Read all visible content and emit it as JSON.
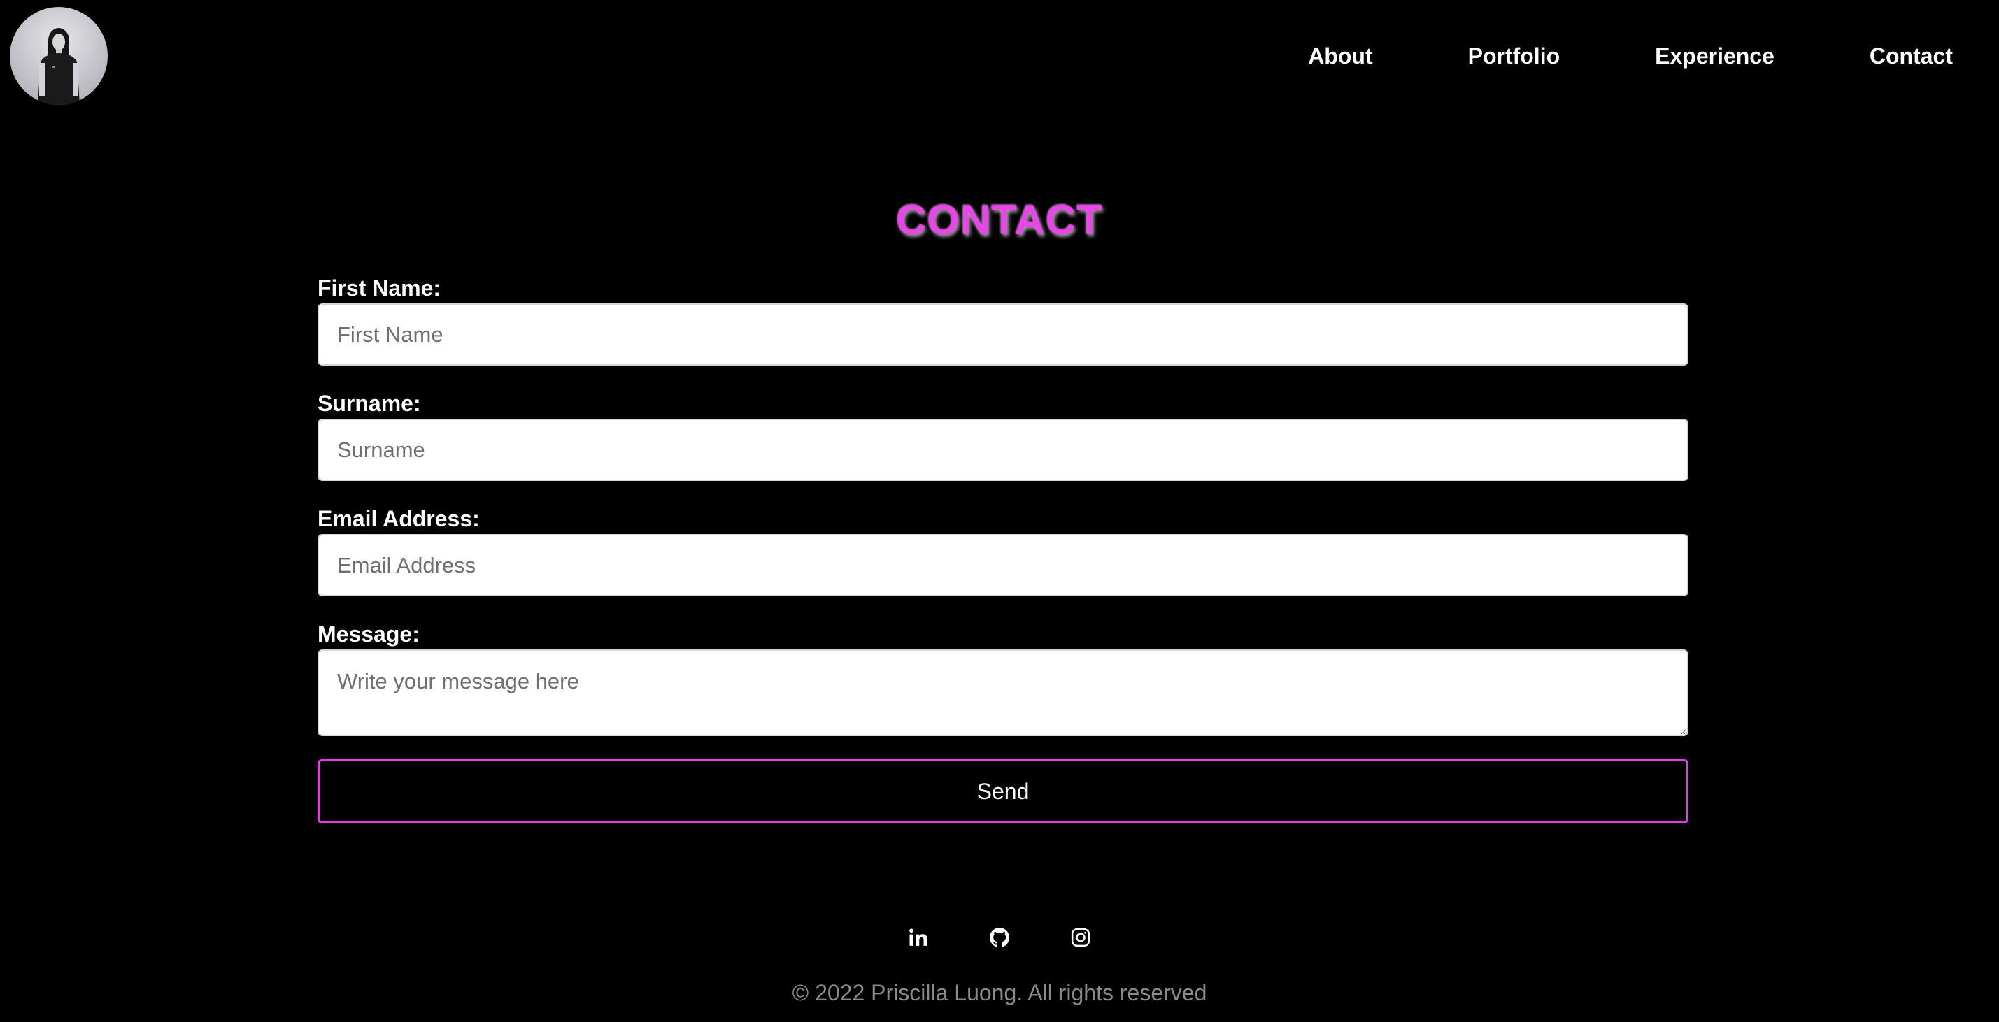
{
  "nav": {
    "items": [
      {
        "label": "About"
      },
      {
        "label": "Portfolio"
      },
      {
        "label": "Experience"
      },
      {
        "label": "Contact"
      }
    ]
  },
  "page": {
    "title": "CONTACT"
  },
  "form": {
    "first_name": {
      "label": "First Name:",
      "placeholder": "First Name"
    },
    "surname": {
      "label": "Surname:",
      "placeholder": "Surname"
    },
    "email": {
      "label": "Email Address:",
      "placeholder": "Email Address"
    },
    "message": {
      "label": "Message:",
      "placeholder": "Write your message here"
    },
    "send_label": "Send"
  },
  "footer": {
    "socials": [
      {
        "icon": "linkedin-icon"
      },
      {
        "icon": "github-icon"
      },
      {
        "icon": "instagram-icon"
      }
    ],
    "copyright": "© 2022 Priscilla Luong. All rights reserved"
  },
  "colors": {
    "background": "#000000",
    "accent": "#e63be6",
    "text": "#ffffff",
    "muted": "#8a8a8a"
  }
}
